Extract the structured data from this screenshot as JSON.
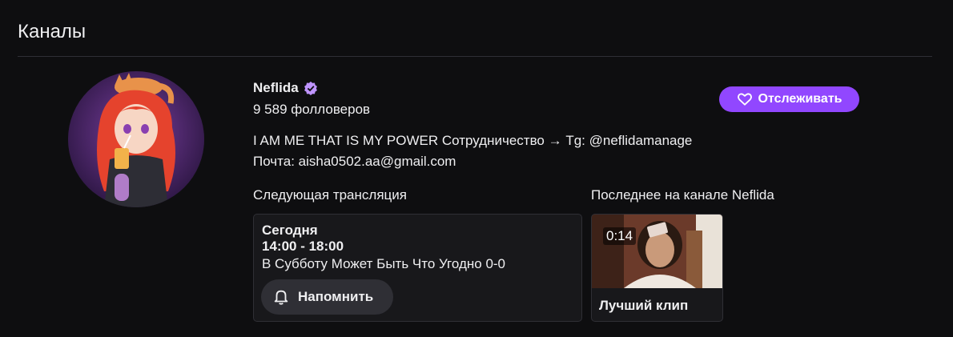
{
  "section": {
    "title": "Каналы"
  },
  "channel": {
    "name": "Neflida",
    "verified_icon": "verified-badge-icon",
    "followers": "9 589 фолловеров",
    "follow_label": "Отслеживать",
    "description_line1": "I AM ME THAT IS MY POWER Сотрудничество → Tg: @neflidamanage",
    "description_line2": "Почта: aisha0502.aa@gmail.com",
    "accent_color": "#9147ff"
  },
  "schedule": {
    "label": "Следующая трансляция",
    "day": "Сегодня",
    "time": "14:00 - 18:00",
    "title": "В Субботу Может Быть Что Угодно 0-0",
    "remind_label": "Напомнить"
  },
  "latest": {
    "label": "Последнее на канале Neflida",
    "clip_duration": "0:14",
    "clip_title": "Лучший клип"
  }
}
